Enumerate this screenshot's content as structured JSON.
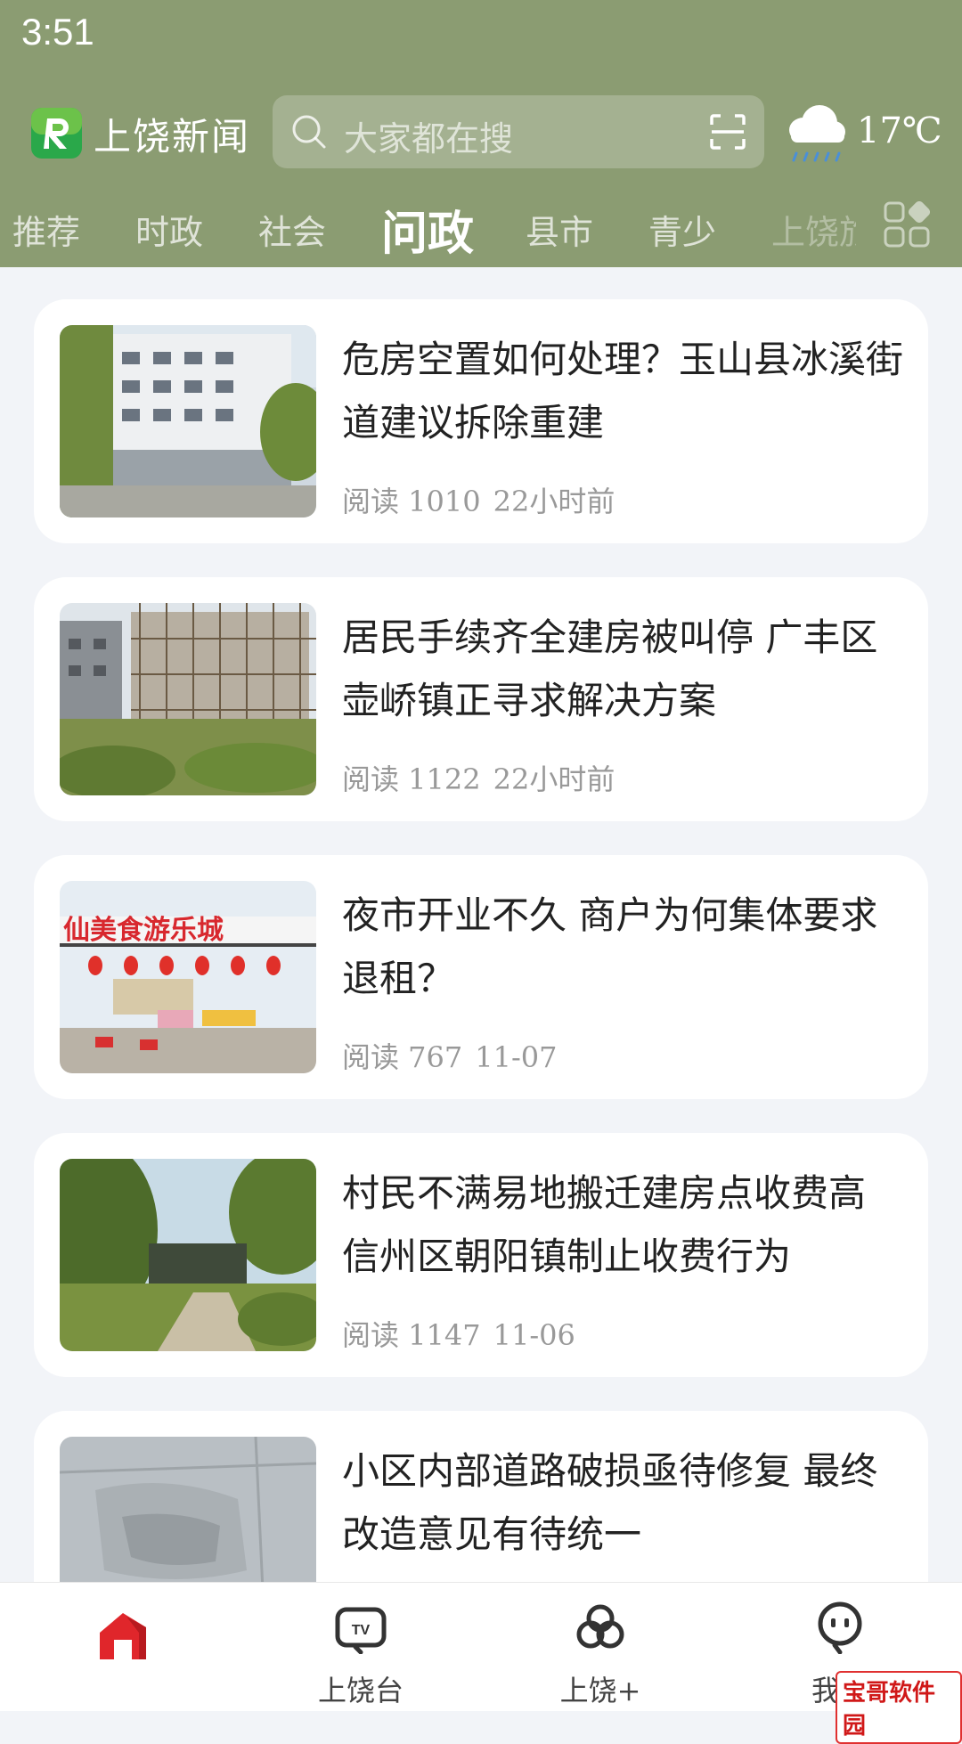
{
  "status_bar": {
    "time": "3:51"
  },
  "header": {
    "app_name": "上饶新闻",
    "search_placeholder": "大家都在搜",
    "temperature": "17℃",
    "weather_icon": "rain-cloud-icon",
    "accent_color": "#8b9c72"
  },
  "tabs": [
    {
      "label": "推荐",
      "active": false
    },
    {
      "label": "时政",
      "active": false
    },
    {
      "label": "社会",
      "active": false
    },
    {
      "label": "问政",
      "active": true
    },
    {
      "label": "县市",
      "active": false
    },
    {
      "label": "青少",
      "active": false
    },
    {
      "label": "上饶旅",
      "active": false
    }
  ],
  "articles": [
    {
      "title": "危房空置如何处理？玉山县冰溪街道建议拆除重建",
      "reads": "阅读 1010",
      "time": "22小时前"
    },
    {
      "title": "居民手续齐全建房被叫停 广丰区壶峤镇正寻求解决方案",
      "reads": "阅读 1122",
      "time": "22小时前"
    },
    {
      "title": "夜市开业不久 商户为何集体要求退租？",
      "reads": "阅读 767",
      "time": "11-07",
      "image_sign_text": "仙美食游乐城"
    },
    {
      "title": "村民不满易地搬迁建房点收费高 信州区朝阳镇制止收费行为",
      "reads": "阅读 1147",
      "time": "11-06"
    },
    {
      "title": "小区内部道路破损亟待修复 最终改造意见有待统一",
      "reads": "",
      "time": ""
    }
  ],
  "bottom_nav": [
    {
      "label": "",
      "icon": "home-icon",
      "active": true
    },
    {
      "label": "上饶台",
      "icon": "tv-icon"
    },
    {
      "label": "上饶+",
      "icon": "circles-icon"
    },
    {
      "label": "我的",
      "icon": "profile-icon"
    }
  ],
  "watermark": "宝哥软件园"
}
